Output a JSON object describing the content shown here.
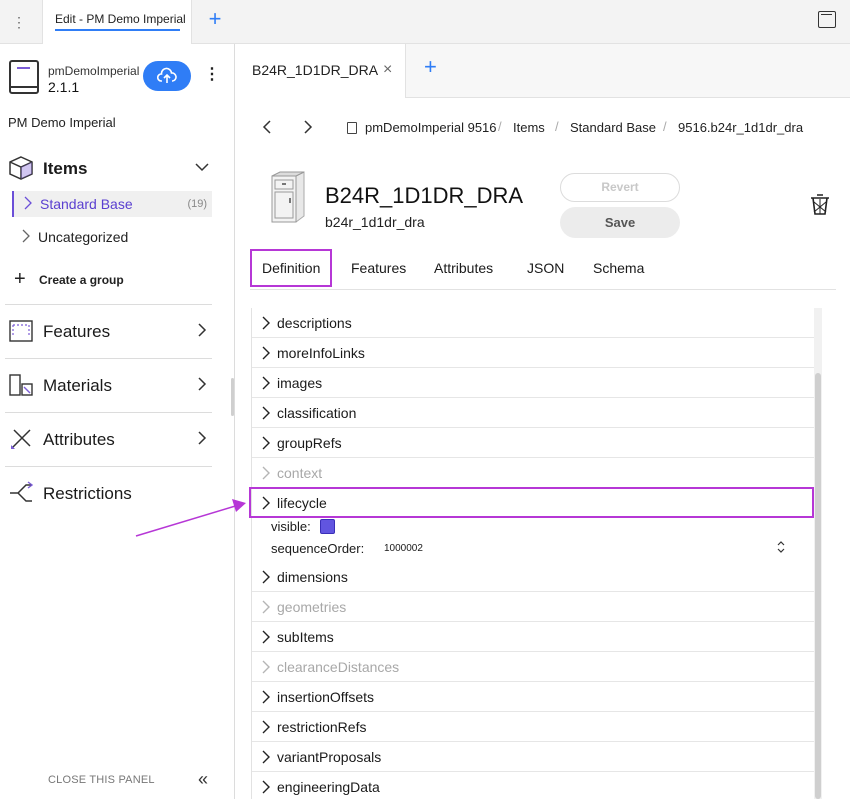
{
  "topbar": {
    "tab_label": "Edit - PM Demo Imperial"
  },
  "sidebar": {
    "project_name": "pmDemoImperial",
    "version": "2.1.1",
    "project_title": "PM Demo Imperial",
    "items_label": "Items",
    "groups": [
      {
        "label": "Standard Base",
        "count": "(19)"
      },
      {
        "label": "Uncategorized"
      }
    ],
    "create_group_label": "Create a group",
    "nav": [
      {
        "label": "Features"
      },
      {
        "label": "Materials"
      },
      {
        "label": "Attributes"
      },
      {
        "label": "Restrictions"
      }
    ],
    "close_panel_label": "CLOSE THIS PANEL"
  },
  "editor_tab": {
    "label": "B24R_1D1DR_DRA"
  },
  "breadcrumb": [
    "pmDemoImperial 9516",
    "Items",
    "Standard Base",
    "9516.b24r_1d1dr_dra"
  ],
  "item": {
    "title": "B24R_1D1DR_DRA",
    "id": "b24r_1d1dr_dra",
    "revert_label": "Revert",
    "save_label": "Save"
  },
  "content_tabs": [
    "Definition",
    "Features",
    "Attributes",
    "JSON",
    "Schema"
  ],
  "tree": {
    "rows": [
      {
        "label": "descriptions",
        "enabled": true
      },
      {
        "label": "moreInfoLinks",
        "enabled": true
      },
      {
        "label": "images",
        "enabled": true
      },
      {
        "label": "classification",
        "enabled": true
      },
      {
        "label": "groupRefs",
        "enabled": true
      },
      {
        "label": "context",
        "enabled": false
      },
      {
        "label": "lifecycle",
        "enabled": true
      }
    ],
    "lifecycle_props": {
      "visible_label": "visible:",
      "sequence_label": "sequenceOrder:",
      "sequence_value": "1000002"
    },
    "rows_after": [
      {
        "label": "dimensions",
        "enabled": true
      },
      {
        "label": "geometries",
        "enabled": false
      },
      {
        "label": "subItems",
        "enabled": true
      },
      {
        "label": "clearanceDistances",
        "enabled": false
      },
      {
        "label": "insertionOffsets",
        "enabled": true
      },
      {
        "label": "restrictionRefs",
        "enabled": true
      },
      {
        "label": "variantProposals",
        "enabled": true
      },
      {
        "label": "engineeringData",
        "enabled": true
      }
    ]
  },
  "colors": {
    "accent": "#2f7df6",
    "highlight": "#b637d6",
    "active_group": "#5a3fd0",
    "checkbox": "#6155e0"
  }
}
